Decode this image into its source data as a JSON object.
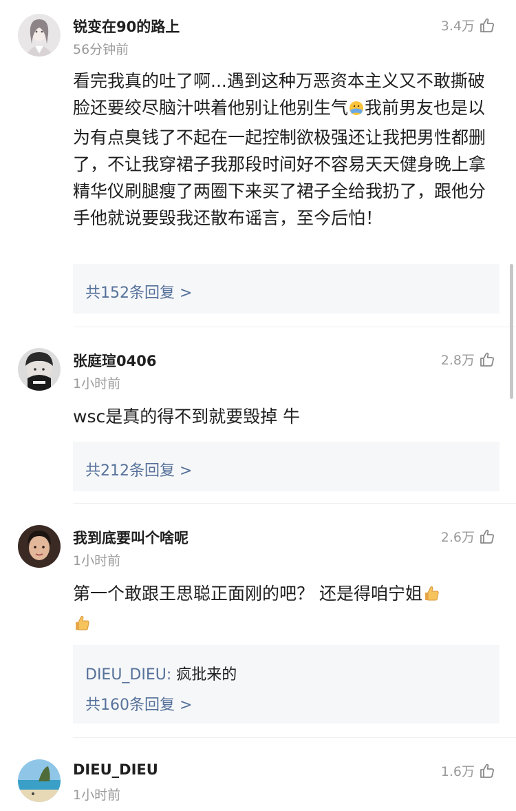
{
  "comments": [
    {
      "username": "锐变在90的路上",
      "time": "56分钟前",
      "likes": "3.4万",
      "content": "看完我真的吐了啊...遇到这种万恶资本主义又不敢撕破脸还要绞尽脑汁哄着他别让他别生气",
      "content_after_emoji": "我前男友也是以为有点臭钱了不起在一起控制欲极强还让我把男性都删了，不让我穿裙子我那段时间好不容易天天健身晚上拿精华仪刷腿瘦了两圈下来买了裙子全给我扔了，跟他分手他就说要毁我还散布谣言，至今后怕！",
      "reply_count_label": "共152条回复 >"
    },
    {
      "username": "张庭瑄0406",
      "time": "1小时前",
      "likes": "2.8万",
      "content": "wsc是真的得不到就要毁掉 牛",
      "reply_count_label": "共212条回复 >"
    },
    {
      "username": "我到底要叫个啥呢",
      "time": "1小时前",
      "likes": "2.6万",
      "content": "第一个敢跟王思聪正面刚的吧？ 还是得咱宁姐",
      "reply_preview_name": "DIEU_DIEU:",
      "reply_preview_text": " 疯批来的",
      "reply_count_label": "共160条回复 >"
    },
    {
      "username": "DIEU_DIEU",
      "time": "1小时前",
      "likes": "1.6万"
    }
  ],
  "icons": {
    "like": "thumbs-up-outline-icon",
    "emoji_1": "face-cover-emoji",
    "emoji_2": "thumbs-up-emoji"
  },
  "colors": {
    "link": "#56719a",
    "muted": "#9a9a9a",
    "reply_bg": "#f6f7f9"
  }
}
